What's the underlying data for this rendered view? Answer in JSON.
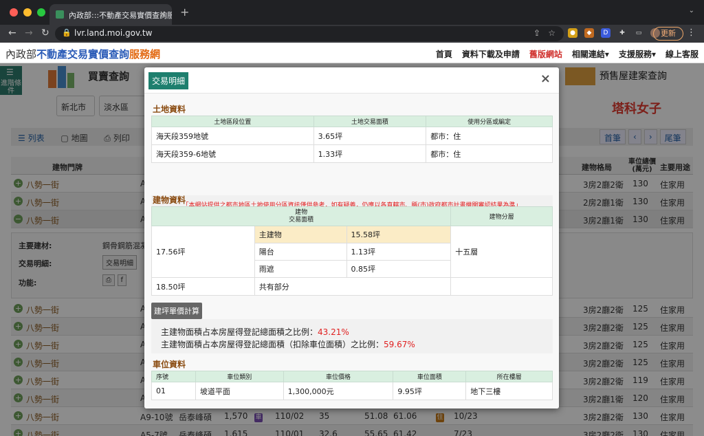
{
  "browser": {
    "tab_title": "內政部:::不動產交易實價查詢服務網",
    "tab_close": "×",
    "new_tab": "+",
    "url": "lvr.land.moi.gov.tw",
    "update_label": "更新",
    "kebab": "⋮"
  },
  "site": {
    "logo_moi": "內政部",
    "logo_main": "不動產交易實價查詢",
    "logo_sub": "服務網",
    "nav": [
      {
        "label": "首頁"
      },
      {
        "label": "資料下載及申請"
      },
      {
        "label": "舊版網站"
      },
      {
        "label": "相關連結▾"
      },
      {
        "label": "支援服務▾"
      },
      {
        "label": "線上客服"
      }
    ]
  },
  "background": {
    "side_button": "進階條件",
    "buy_sell": "買賣查詢",
    "presale": "預售屋建案查詢",
    "city": "新北市",
    "district": "淡水區",
    "brand": "塔科女子",
    "view_list": "列表",
    "view_map": "地圖",
    "print": "列印",
    "first_page": "首筆",
    "prev": "‹",
    "next": "›",
    "last_page": "尾筆",
    "head_addr": "建物門牌",
    "head_layout": "建物格局",
    "head_park_price": "車位總價(萬元)",
    "head_use": "主要用途",
    "detail_material_label": "主要建材:",
    "detail_material_value": "鋼骨鋼筋混凝",
    "detail_txn_label": "交易明細:",
    "detail_txn_btn": "交易明細",
    "detail_func_label": "功能:",
    "rows": [
      {
        "addr": "八勢一街",
        "a": "A",
        "layout": "3房2廳2衛",
        "park": "130",
        "use": "住家用"
      },
      {
        "addr": "八勢一街",
        "a": "A",
        "layout": "2房2廳1衛",
        "park": "130",
        "use": "住家用"
      },
      {
        "addr": "八勢一街",
        "a": "A",
        "layout": "3房2廳1衛",
        "park": "130",
        "use": "住家用"
      },
      {
        "addr": "八勢一街",
        "a": "A",
        "layout": "3房2廳2衛",
        "park": "125",
        "use": "住家用"
      },
      {
        "addr": "八勢一街",
        "a": "A",
        "layout": "3房2廳2衛",
        "park": "125",
        "use": "住家用"
      },
      {
        "addr": "八勢一街",
        "a": "A",
        "layout": "3房2廳2衛",
        "park": "125",
        "use": "住家用"
      },
      {
        "addr": "八勢一街",
        "a": "A",
        "layout": "3房2廳2衛",
        "park": "125",
        "use": "住家用"
      },
      {
        "addr": "八勢一街",
        "a": "A",
        "layout": "3房2廳2衛",
        "park": "119",
        "use": "住家用"
      },
      {
        "addr": "八勢一街",
        "a": "A",
        "layout": "3房2廳1衛",
        "park": "120",
        "use": "住家用"
      },
      {
        "addr": "八勢一街",
        "a": "A9-10號",
        "name": "岳泰峰碩",
        "price": "1,570",
        "date": "110/02",
        "floor_no": "35",
        "area1": "51.08",
        "area2": "61.06",
        "floor": "10/23",
        "layout": "3房2廳2衛",
        "park": "130",
        "use": "住家用"
      },
      {
        "addr": "八勢一街",
        "a": "A5-7號",
        "name": "岳泰峰碩",
        "price": "1,615",
        "date": "110/01",
        "floor_no": "32.6",
        "area1": "55.65",
        "area2": "61.42",
        "floor": "7/23",
        "layout": "3房2廳2衛",
        "park": "130",
        "use": "住家用"
      }
    ]
  },
  "modal": {
    "title": "交易明細",
    "close": "×",
    "land": {
      "section": "土地資料",
      "headers": [
        "土地區段位置",
        "土地交易面積",
        "使用分區或編定"
      ],
      "rows": [
        [
          "海天段359地號",
          "3.65坪",
          "都市：住"
        ],
        [
          "海天段359-6地號",
          "1.33坪",
          "都市：住"
        ]
      ]
    },
    "notice": "「本網站提供之都市地區土地使用分區資訊僅供參考，如有疑義，仍應以各直轄市、縣(市)政府都市計畫機關審認結果為準」",
    "building": {
      "section": "建物資料",
      "header_area_1": "建物",
      "header_area_2": "交易面積",
      "header_floor": "建物分層",
      "total_area": "17.56坪",
      "main_label": "主建物",
      "main_value": "15.58坪",
      "balcony_label": "陽台",
      "balcony_value": "1.13坪",
      "shelter_label": "雨遮",
      "shelter_value": "0.85坪",
      "floor_value": "十五層",
      "common_area": "18.50坪",
      "common_label": "共有部分"
    },
    "calc_button": "建坪單價計算",
    "ratio": {
      "line1_label": "主建物面積占本房屋得登記總面積之比例：",
      "line1_value": "43.21%",
      "line2_label": "主建物面積占本房屋得登記總面積（扣除車位面積）之比例：",
      "line2_value": "59.67%"
    },
    "parking": {
      "section": "車位資料",
      "headers": [
        "序號",
        "車位類別",
        "車位價格",
        "車位面積",
        "所在樓層"
      ],
      "rows": [
        [
          "01",
          "坡道平面",
          "1,300,000元",
          "9.95坪",
          "地下三樓"
        ]
      ]
    }
  }
}
